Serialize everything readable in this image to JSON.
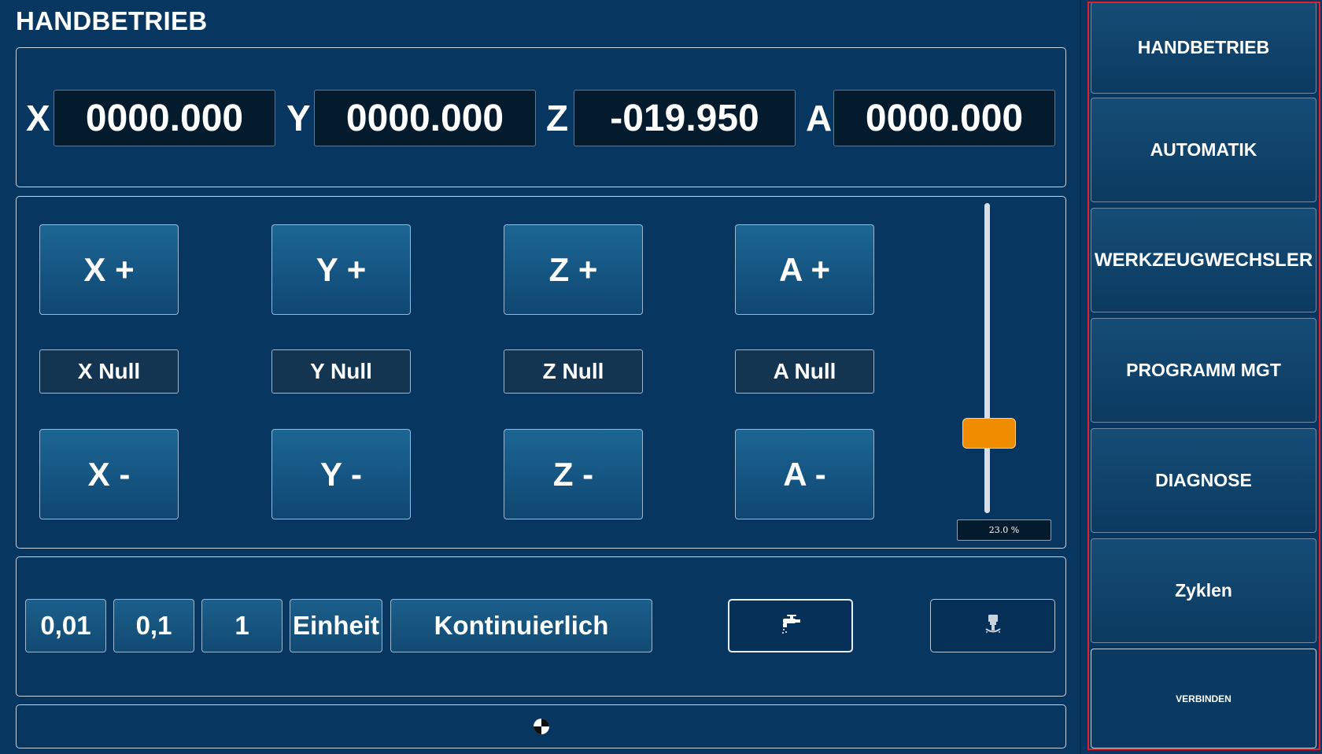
{
  "page_title": "HANDBETRIEB",
  "coordinates": [
    {
      "axis": "X",
      "value": "0000.000"
    },
    {
      "axis": "Y",
      "value": "0000.000"
    },
    {
      "axis": "Z",
      "value": "-019.950"
    },
    {
      "axis": "A",
      "value": "0000.000"
    }
  ],
  "jog": {
    "plus": [
      "X +",
      "Y +",
      "Z +",
      "A +"
    ],
    "null": [
      "X Null",
      "Y Null",
      "Z Null",
      "A Null"
    ],
    "minus": [
      "X -",
      "Y -",
      "Z -",
      "A -"
    ]
  },
  "feed_override": {
    "value_text": "23.0 %",
    "fraction": 0.23,
    "thumb_color": "#f08c00"
  },
  "step": {
    "options": [
      "0,01",
      "0,1",
      "1",
      "Einheit",
      "Kontinuierlich"
    ]
  },
  "tools": {
    "coolant_icon": "faucet-icon",
    "spindle_icon": "spindle-icon"
  },
  "status_bar": {
    "icon": "reference-point-icon"
  },
  "nav": {
    "items": [
      "HANDBETRIEB",
      "AUTOMATIK",
      "WERKZEUGWECHSLER",
      "PROGRAMM MGT",
      "DIAGNOSE",
      "Zyklen",
      "VERBINDEN"
    ]
  },
  "colors": {
    "background": "#073660",
    "highlight_frame": "#e0202e",
    "display_bg": "#041a2d"
  }
}
